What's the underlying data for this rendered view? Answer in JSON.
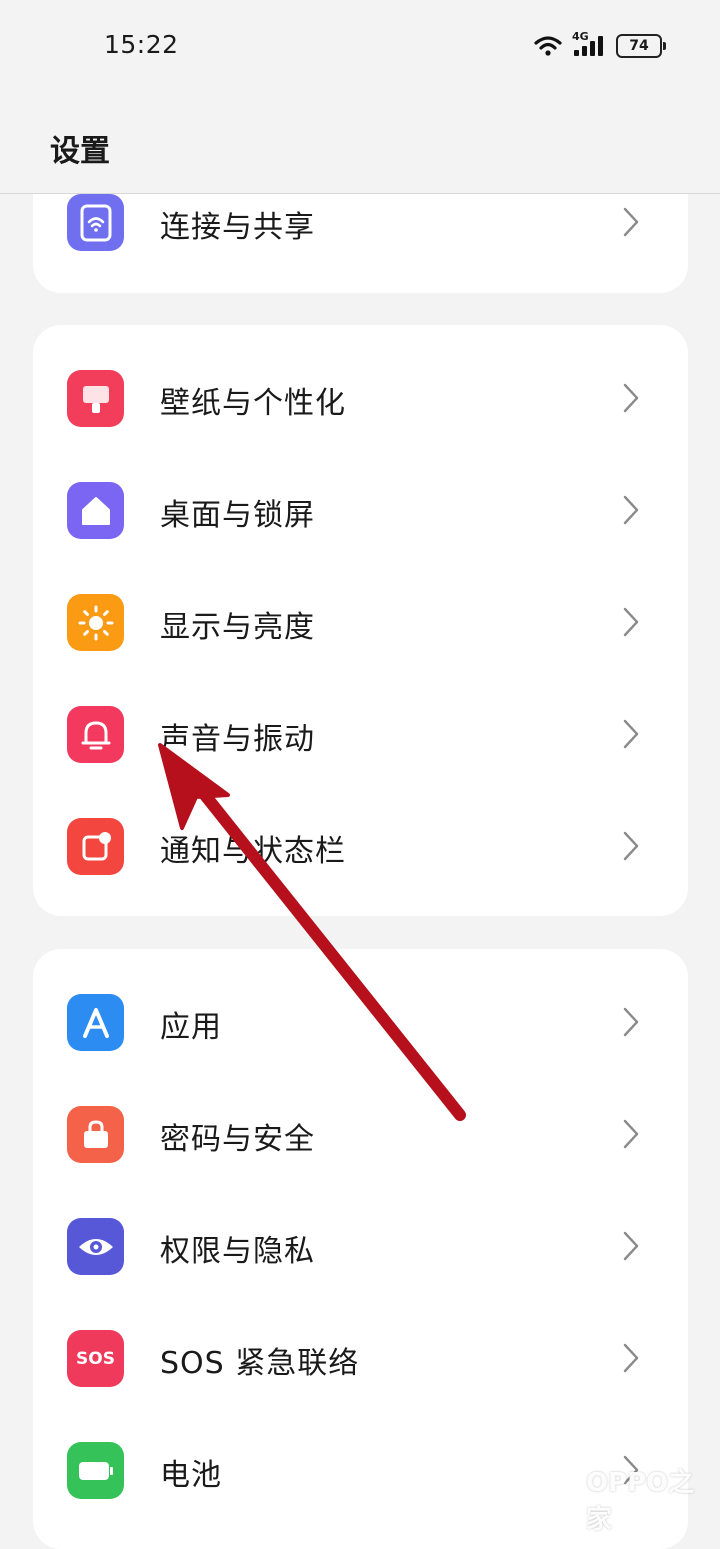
{
  "status_bar": {
    "time": "15:22",
    "network": "4G",
    "battery": "74"
  },
  "header": {
    "title": "设置"
  },
  "groups": [
    {
      "items": [
        {
          "label": "连接与共享",
          "icon": "wifi-icon",
          "color": "#6f6ff0"
        }
      ]
    },
    {
      "items": [
        {
          "label": "壁纸与个性化",
          "icon": "wallpaper-icon",
          "color": "#f23d5b"
        },
        {
          "label": "桌面与锁屏",
          "icon": "home-icon",
          "color": "#7a66f2"
        },
        {
          "label": "显示与亮度",
          "icon": "sun-icon",
          "color": "#fb9a13"
        },
        {
          "label": "声音与振动",
          "icon": "bell-icon",
          "color": "#f3395d"
        },
        {
          "label": "通知与状态栏",
          "icon": "notification-icon",
          "color": "#f2463e"
        }
      ]
    },
    {
      "items": [
        {
          "label": "应用",
          "icon": "apps-icon",
          "color": "#2d8cf2"
        },
        {
          "label": "密码与安全",
          "icon": "lock-bag-icon",
          "color": "#f5624a"
        },
        {
          "label": "权限与隐私",
          "icon": "eye-icon",
          "color": "#5758d8"
        },
        {
          "label": "SOS 紧急联络",
          "icon": "sos-icon",
          "color": "#f03a5c"
        },
        {
          "label": "电池",
          "icon": "battery-icon",
          "color": "#34c259"
        }
      ]
    }
  ],
  "sos_text": "SOS",
  "watermark": {
    "text": "OPPO之家"
  },
  "annotation": {
    "color": "#b5101c"
  }
}
